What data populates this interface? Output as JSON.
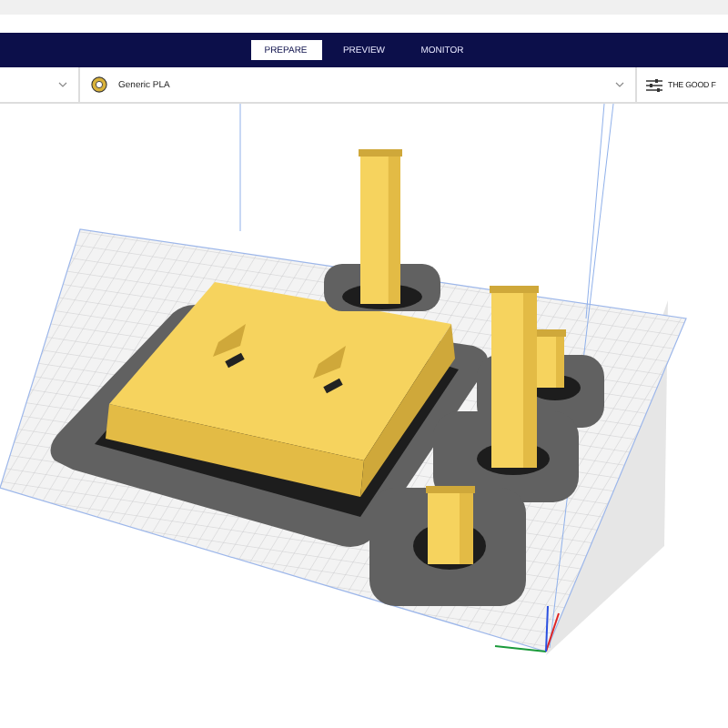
{
  "header": {
    "tabs": [
      {
        "label": "PREPARE",
        "selected": true
      },
      {
        "label": "PREVIEW",
        "selected": false
      },
      {
        "label": "MONITOR",
        "selected": false
      }
    ]
  },
  "toolbar": {
    "material": {
      "label": "Generic PLA"
    },
    "profile": {
      "label": "THE GOOD F"
    }
  }
}
